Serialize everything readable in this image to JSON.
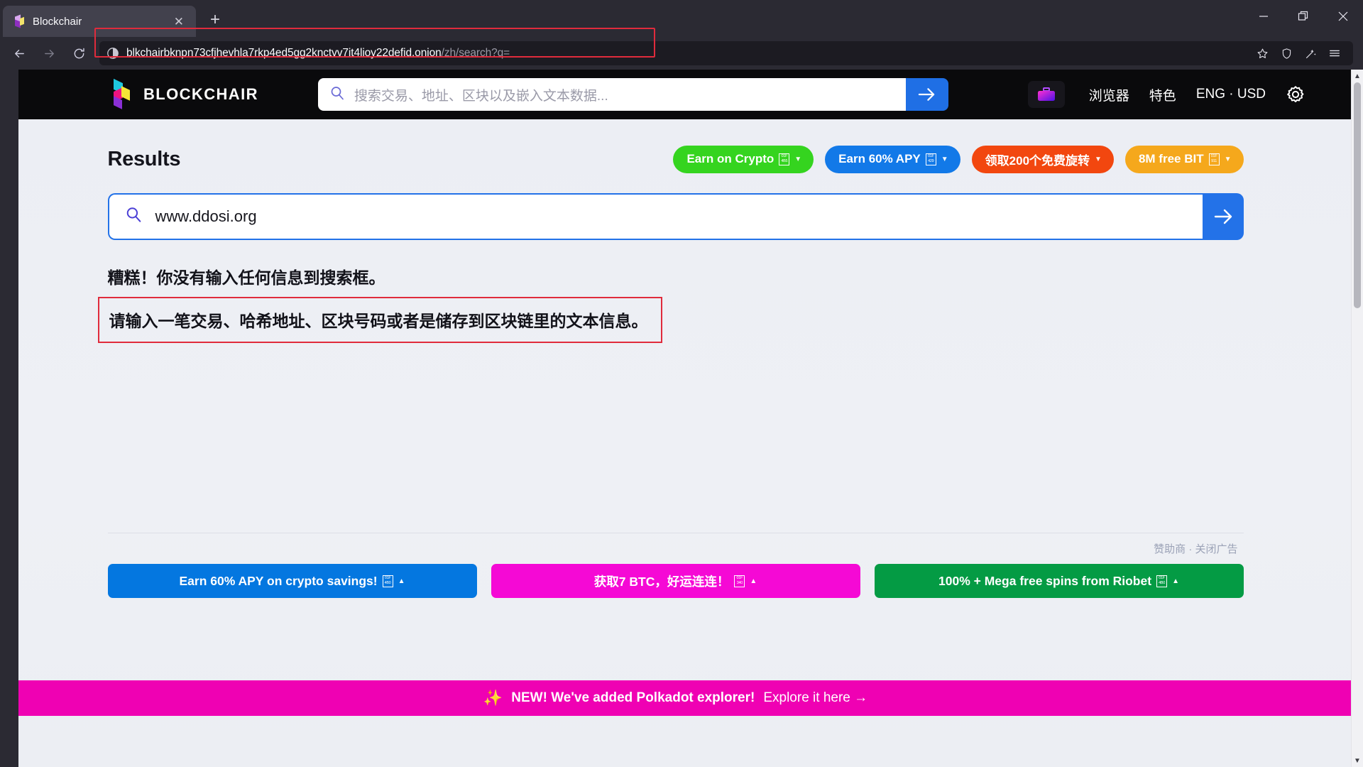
{
  "browser": {
    "tab": {
      "title": "Blockchair",
      "close_label": "✕",
      "favicon": "blockchair-favicon"
    },
    "newtab_label": "+",
    "window_controls": {
      "minimize": "minimize-icon",
      "maximize": "maximize-icon",
      "close": "close-icon"
    },
    "nav": {
      "back": "back-arrow-icon",
      "forward": "forward-arrow-icon",
      "reload": "reload-icon"
    },
    "url": {
      "host": "blkchairbknpn73cfjhevhla7rkp4ed5gg2knctvv7it4lioy22defid.onion",
      "path": "/zh/search?q=",
      "security_icon": "onion-shield-icon"
    },
    "url_actions": {
      "bookmark": "star-icon",
      "shield": "shield-icon",
      "sparkle": "sparkle-wand-icon",
      "menu": "hamburger-menu-icon"
    }
  },
  "site": {
    "logo_text": "BLOCKCHAIR",
    "header_search": {
      "placeholder": "搜索交易、地址、区块以及嵌入文本数据...",
      "value": "",
      "submit_icon": "arrow-right-icon",
      "search_icon": "magnifier-icon"
    },
    "nav_links": [
      {
        "label": "浏览器",
        "name": "explorers"
      },
      {
        "label": "特色",
        "name": "features"
      },
      {
        "label": "ENG · USD",
        "name": "language-currency"
      }
    ],
    "briefcase_icon": "briefcase-icon",
    "gear_icon": "gear-icon"
  },
  "main": {
    "title": "Results",
    "promos": [
      {
        "label": "Earn on Crypto",
        "tofu": [
          "01F",
          "4B5"
        ],
        "color": "#35d41f",
        "caret": "▼"
      },
      {
        "label": "Earn 60% APY",
        "tofu": [
          "01F",
          "429"
        ],
        "color": "#1279e8",
        "caret": "▼"
      },
      {
        "label": "领取200个免费旋转",
        "tofu": null,
        "color": "#f2470f",
        "caret": "▼"
      },
      {
        "label": "8M free BIT",
        "tofu": [
          "01F",
          "911"
        ],
        "color": "#f5a81c",
        "caret": "▼"
      }
    ],
    "search": {
      "value": "www.ddosi.org",
      "placeholder": "",
      "search_icon": "magnifier-icon",
      "submit_icon": "arrow-right-icon"
    },
    "error_primary": "糟糕！你没有输入任何信息到搜索框。",
    "error_secondary": "请输入一笔交易、哈希地址、区块号码或者是储存到区块链里的文本信息。",
    "sponsor_text": "赞助商 · 关闭广告",
    "ads": [
      {
        "label": "Earn 60% APY on crypto savings!",
        "tofu": [
          "01F",
          "4B0"
        ],
        "color": "#0477e0",
        "caret": "▲"
      },
      {
        "label": "获取7 BTC，好运连连！",
        "tofu": [
          "01F",
          "340"
        ],
        "color": "#f509d5",
        "caret": "▲"
      },
      {
        "label": "100% + Mega free spins from Riobet",
        "tofu": [
          "01F",
          "4B0"
        ],
        "color": "#049b44",
        "caret": "▲"
      }
    ],
    "polkadot_banner": {
      "sparkle": "✨",
      "bold": "NEW! We've added Polkadot explorer!",
      "light": "Explore it here →"
    }
  },
  "colors": {
    "accent_blue": "#2372e8",
    "error_red": "#e02b3c",
    "banner_pink": "#ef01b3",
    "chrome_bg": "#2b2a33",
    "urlbar_bg": "#1c1b22"
  },
  "scrollbar": {
    "up": "▲",
    "down": "▼"
  }
}
